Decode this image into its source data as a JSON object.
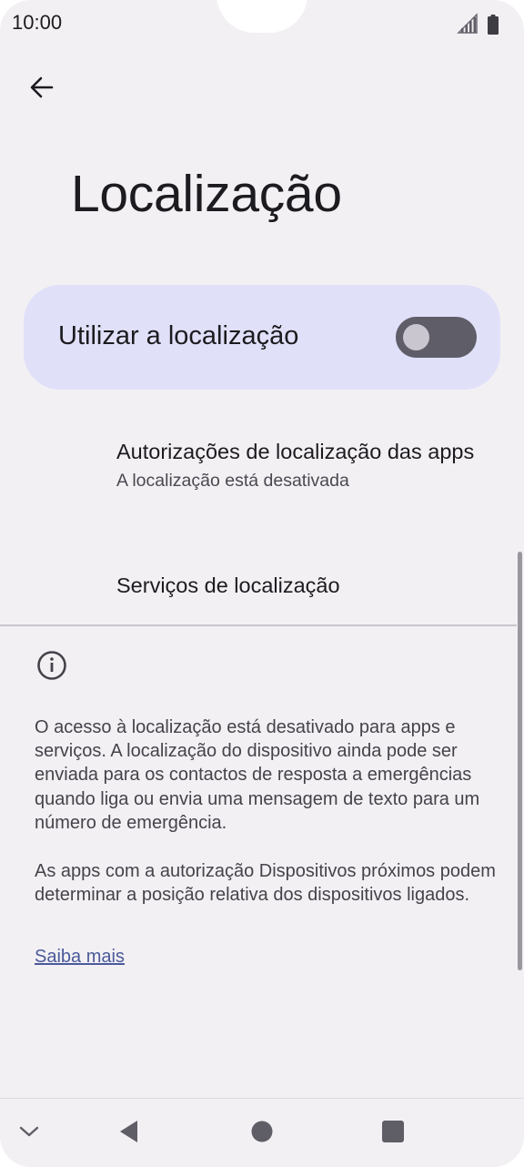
{
  "status_bar": {
    "time": "10:00",
    "signal_icon": "signal-icon",
    "battery_icon": "battery-icon"
  },
  "header": {
    "back_icon": "back-arrow-icon",
    "title": "Localização"
  },
  "main_toggle": {
    "label": "Utilizar a localização",
    "state": "off"
  },
  "list_items": [
    {
      "title": "Autorizações de localização das apps",
      "subtitle": "A localização está desativada"
    },
    {
      "title": "Serviços de localização"
    }
  ],
  "footer": {
    "info_icon": "info-icon",
    "paragraph1": "O acesso à localização está desativado para apps e serviços. A localização do dispositivo ainda pode ser enviada para os contactos de resposta a emergências quando liga ou envia uma mensagem de texto para um número de emergência.",
    "paragraph2": "As apps com a autorização Dispositivos próximos podem determinar a posição relativa dos dispositivos ligados.",
    "link": "Saiba mais"
  },
  "nav_bar": {
    "items": [
      "chevron-down-icon",
      "back-triangle-icon",
      "home-circle-icon",
      "recents-square-icon"
    ]
  },
  "colors": {
    "background": "#f3f0f4",
    "toggle_card": "#e0e0f9",
    "switch_off_track": "#5f5d68",
    "link": "#4a5a9a"
  }
}
